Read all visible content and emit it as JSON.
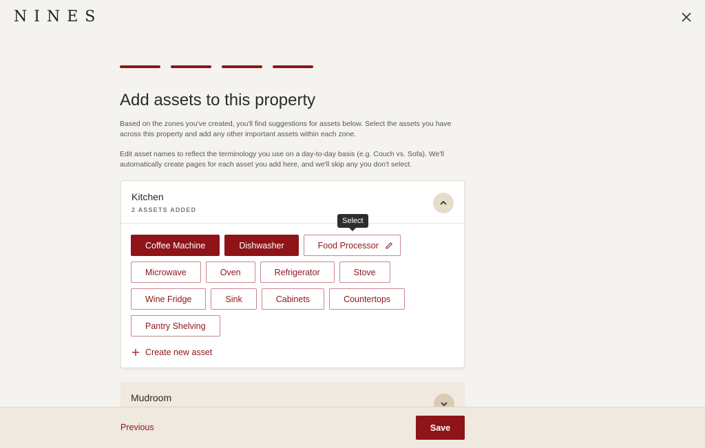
{
  "brand": {
    "logo": "NINES"
  },
  "header": {
    "title": "Add assets to this property"
  },
  "description": {
    "p1": "Based on the zones you've created, you'll find suggestions for assets below. Select the assets you have across this property and add any other important assets within each zone.",
    "p2": "Edit asset names to reflect the terminology you use on a day-to-day basis (e.g. Couch vs. Sofa). We'll automatically create pages for each asset you add here, and we'll skip any you don't select."
  },
  "progress": {
    "steps_total": 4,
    "steps_done": 4
  },
  "zones": [
    {
      "name": "Kitchen",
      "count_label": "2 ASSETS ADDED",
      "assets": [
        {
          "label": "Coffee Machine",
          "selected": true
        },
        {
          "label": "Dishwasher",
          "selected": true
        },
        {
          "label": "Food Processor",
          "selected": false
        },
        {
          "label": "Microwave",
          "selected": false
        },
        {
          "label": "Oven",
          "selected": false
        },
        {
          "label": "Refrigerator",
          "selected": false
        },
        {
          "label": "Stove",
          "selected": false
        },
        {
          "label": "Wine Fridge",
          "selected": false
        },
        {
          "label": "Sink",
          "selected": false
        },
        {
          "label": "Cabinets",
          "selected": false
        },
        {
          "label": "Countertops",
          "selected": false
        },
        {
          "label": "Pantry Shelving",
          "selected": false
        }
      ],
      "create_label": "Create new asset"
    },
    {
      "name": "Mudroom"
    }
  ],
  "tooltip": {
    "text": "Select"
  },
  "footer": {
    "previous_label": "Previous",
    "save_label": "Save"
  },
  "colors": {
    "accent": "#8e1418",
    "background": "#f5f3ef",
    "footer": "#efe9df"
  }
}
